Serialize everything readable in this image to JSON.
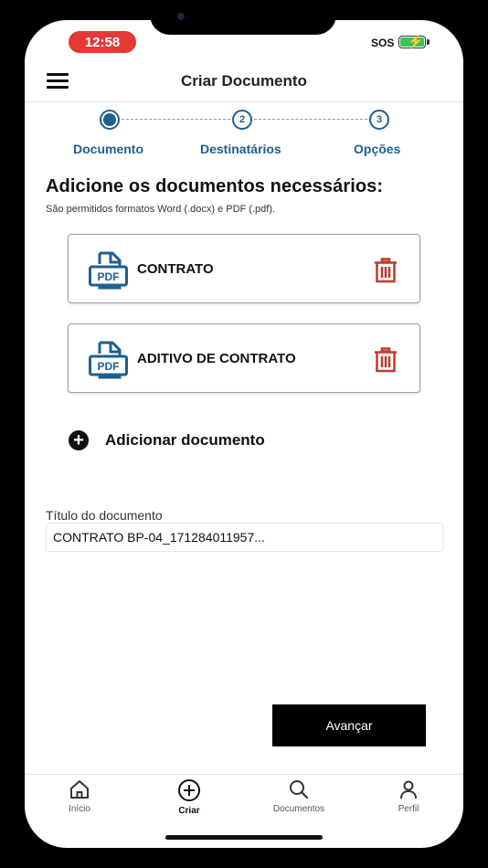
{
  "status_bar": {
    "time": "12:58",
    "carrier": "SOS"
  },
  "header": {
    "title": "Criar Documento"
  },
  "stepper": {
    "steps": [
      {
        "label": "Documento",
        "number": "1"
      },
      {
        "label": "Destinatários",
        "number": "2"
      },
      {
        "label": "Opções",
        "number": "3"
      }
    ],
    "current_step": 1
  },
  "content": {
    "heading": "Adicione os documentos necessários:",
    "subheading": "São permitidos formatos Word (.docx) e PDF (.pdf).",
    "documents": [
      {
        "name": "CONTRATO",
        "icon_text": "PDF"
      },
      {
        "name": "ADITIVO DE CONTRATO",
        "icon_text": "PDF"
      }
    ],
    "add_document_label": "Adicionar documento",
    "title_field": {
      "label": "Título do documento",
      "value": "CONTRATO BP-04_171284011957..."
    },
    "next_button": "Avançar"
  },
  "tab_bar": {
    "items": [
      {
        "label": "Início",
        "icon": "home-icon"
      },
      {
        "label": "Criar",
        "icon": "plus-circle-icon",
        "active": true
      },
      {
        "label": "Documentos",
        "icon": "search-icon"
      },
      {
        "label": "Perfil",
        "icon": "user-icon"
      }
    ]
  },
  "colors": {
    "accent": "#1f5f91",
    "delete": "#c0392b",
    "status_time_bg": "#e53935",
    "battery": "#3bc45a"
  }
}
